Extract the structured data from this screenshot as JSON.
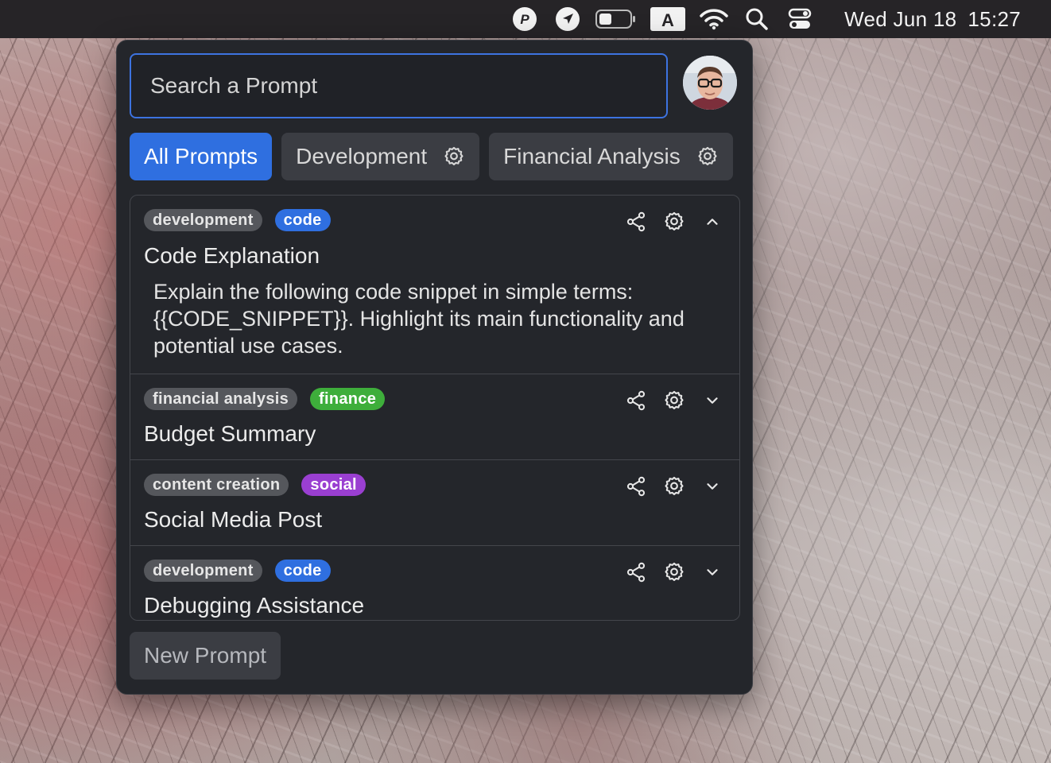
{
  "menubar": {
    "icons": [
      "p-circle-icon",
      "location-arrow-icon",
      "battery-icon",
      "input-source-icon",
      "wifi-icon",
      "search-icon",
      "control-center-icon"
    ],
    "input_source_label": "A",
    "p_label": "P",
    "date": "Wed Jun 18",
    "time": "15:27"
  },
  "search": {
    "placeholder": "Search a Prompt",
    "value": ""
  },
  "tabs": [
    {
      "label": "All Prompts",
      "active": true,
      "has_gear": false
    },
    {
      "label": "Development",
      "active": false,
      "has_gear": true
    },
    {
      "label": "Financial Analysis",
      "active": false,
      "has_gear": true
    }
  ],
  "prompts": [
    {
      "badges": [
        {
          "text": "development",
          "color": "gray"
        },
        {
          "text": "code",
          "color": "blue"
        }
      ],
      "title": "Code Explanation",
      "expanded": true,
      "description": "Explain the following code snippet in simple terms: {{CODE_SNIPPET}}. Highlight its main functionality and potential use cases."
    },
    {
      "badges": [
        {
          "text": "financial analysis",
          "color": "gray"
        },
        {
          "text": "finance",
          "color": "green"
        }
      ],
      "title": "Budget Summary",
      "expanded": false
    },
    {
      "badges": [
        {
          "text": "content creation",
          "color": "gray"
        },
        {
          "text": "social",
          "color": "purple"
        }
      ],
      "title": "Social Media Post",
      "expanded": false
    },
    {
      "badges": [
        {
          "text": "development",
          "color": "gray"
        },
        {
          "text": "code",
          "color": "blue"
        }
      ],
      "title": "Debugging Assistance",
      "expanded": false
    }
  ],
  "new_prompt_label": "New Prompt",
  "colors": {
    "accent": "#2f6fe0",
    "panel_bg": "#24262b",
    "badge_green": "#3eae3b",
    "badge_purple": "#9a3fd1"
  }
}
